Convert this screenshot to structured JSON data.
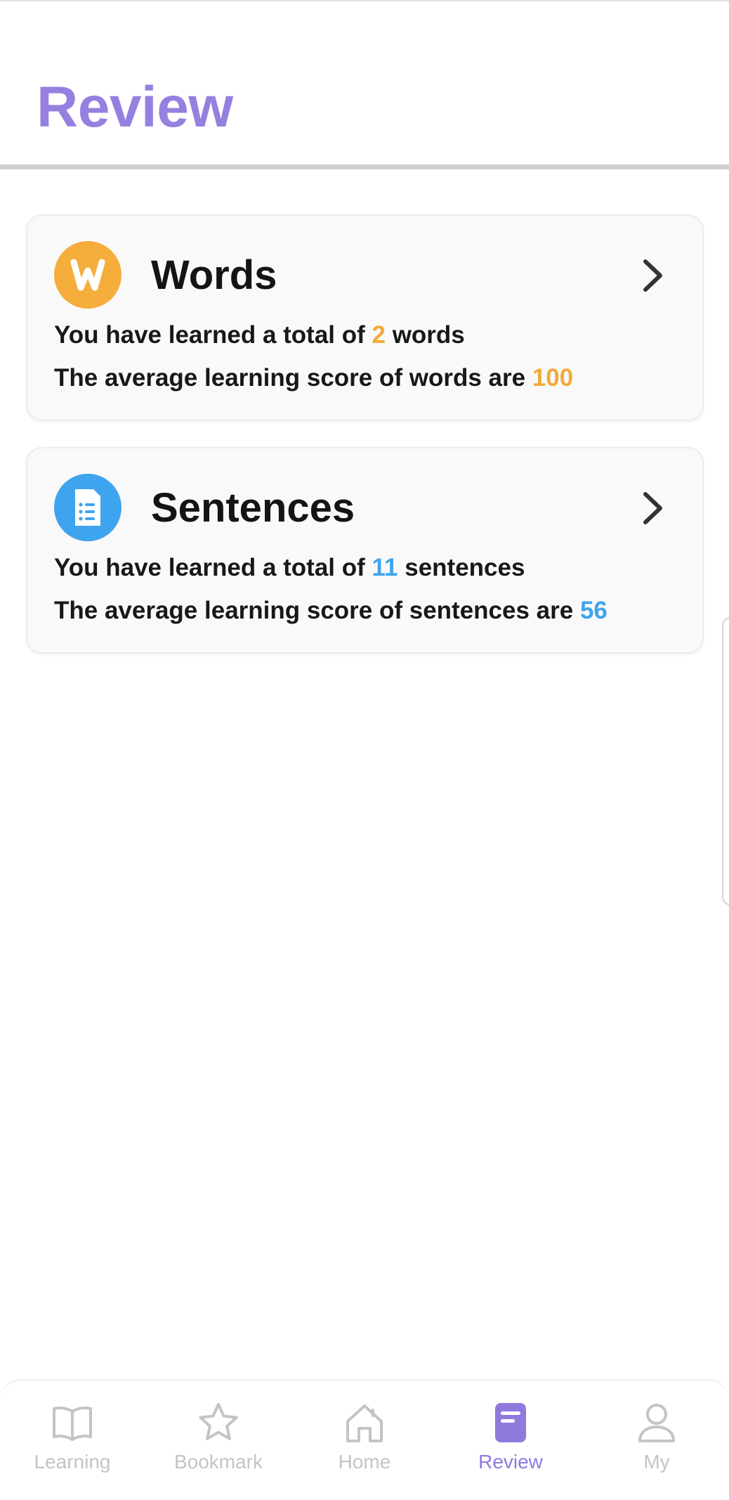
{
  "header": {
    "title": "Review"
  },
  "cards": [
    {
      "title": "Words",
      "icon": "w-letter-icon",
      "line1_prefix": "You have learned a total of ",
      "line1_value": "2",
      "line1_suffix": " words",
      "line2_prefix": "The average learning score of words are ",
      "line2_value": "100",
      "accent": "#f5ad3c"
    },
    {
      "title": "Sentences",
      "icon": "document-list-icon",
      "line1_prefix": "You have learned a total of ",
      "line1_value": "11",
      "line1_suffix": " sentences",
      "line2_prefix": "The average learning score of sentences are ",
      "line2_value": "56",
      "accent": "#3fa4ee"
    }
  ],
  "tabbar": {
    "items": [
      {
        "label": "Learning",
        "icon": "open-book-icon",
        "active": false
      },
      {
        "label": "Bookmark",
        "icon": "star-icon",
        "active": false
      },
      {
        "label": "Home",
        "icon": "home-icon",
        "active": false
      },
      {
        "label": "Review",
        "icon": "review-document-icon",
        "active": true
      },
      {
        "label": "My",
        "icon": "user-icon",
        "active": false
      }
    ],
    "active_color": "#8f79dd",
    "inactive_color": "#c4c4c4"
  },
  "colors": {
    "title": "#9580e0"
  }
}
